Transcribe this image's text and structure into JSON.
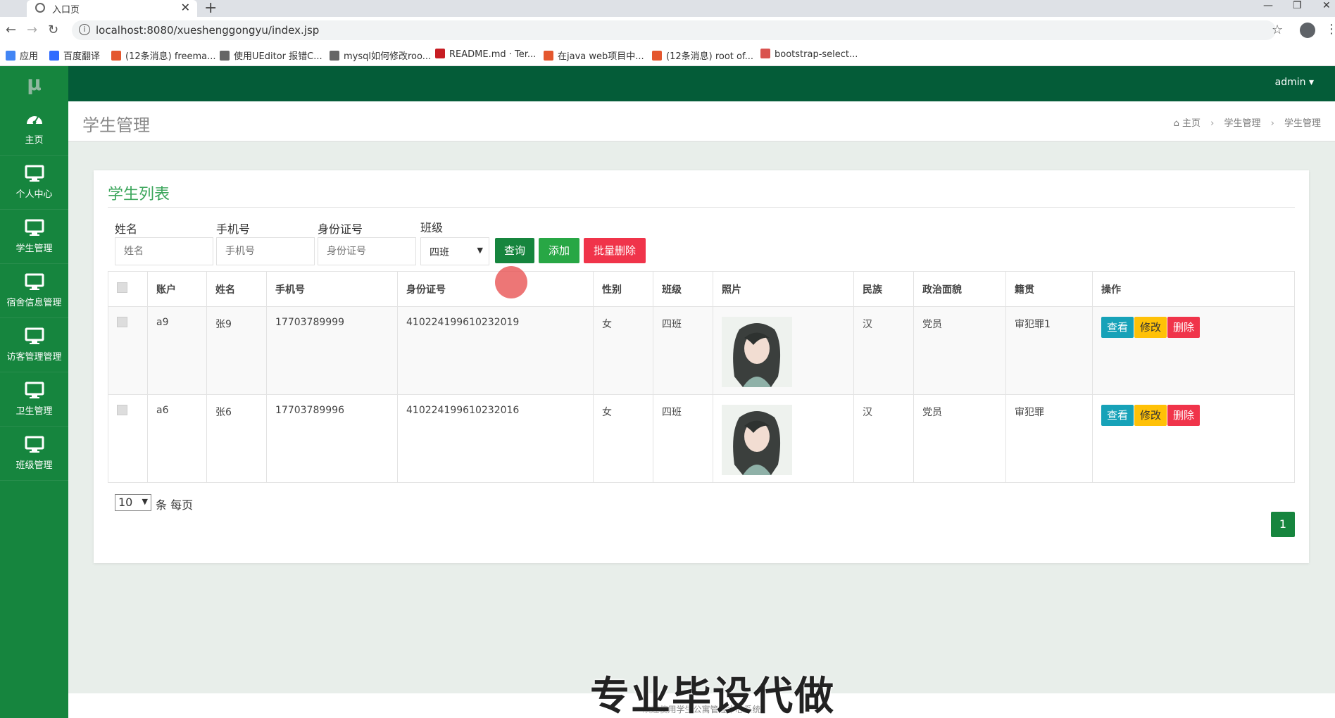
{
  "browser": {
    "tab_title": "入口页",
    "tab_close": "✕",
    "new_tab": "+",
    "url": "localhost:8080/xueshenggongyu/index.jsp",
    "bookmarks": [
      {
        "label": "应用",
        "color": "#4285f4"
      },
      {
        "label": "百度翻译",
        "color": "#2f6bff"
      },
      {
        "label": "(12条消息) freema...",
        "color": "#e4572e"
      },
      {
        "label": "使用UEditor 报错C...",
        "color": "#666666"
      },
      {
        "label": "mysql如何修改roo...",
        "color": "#666666"
      },
      {
        "label": "README.md · Ter...",
        "color": "#c71d23"
      },
      {
        "label": "在java web项目中...",
        "color": "#e4572e"
      },
      {
        "label": "(12条消息) root of...",
        "color": "#e4572e"
      },
      {
        "label": "bootstrap-select...",
        "color": "#d9534f"
      }
    ]
  },
  "sidebar": {
    "logo": "μ",
    "items": [
      {
        "label": "主页",
        "icon": "dashboard-icon"
      },
      {
        "label": "个人中心",
        "icon": "monitor-icon"
      },
      {
        "label": "学生管理",
        "icon": "monitor-icon"
      },
      {
        "label": "宿舍信息管理",
        "icon": "monitor-icon"
      },
      {
        "label": "访客管理管理",
        "icon": "monitor-icon"
      },
      {
        "label": "卫生管理",
        "icon": "monitor-icon"
      },
      {
        "label": "班级管理",
        "icon": "monitor-icon"
      }
    ]
  },
  "topbar": {
    "user": "admin ▾"
  },
  "header": {
    "title": "学生管理",
    "breadcrumb": [
      "主页",
      "学生管理",
      "学生管理"
    ]
  },
  "card": {
    "title": "学生列表"
  },
  "filters": {
    "name_label": "姓名",
    "name_placeholder": "姓名",
    "phone_label": "手机号",
    "phone_placeholder": "手机号",
    "id_label": "身份证号",
    "id_placeholder": "身份证号",
    "class_label": "班级",
    "class_value": "四班",
    "search_btn": "查询",
    "add_btn": "添加",
    "batch_delete_btn": "批量删除"
  },
  "table": {
    "headers": [
      "账户",
      "姓名",
      "手机号",
      "身份证号",
      "性别",
      "班级",
      "照片",
      "民族",
      "政治面貌",
      "籍贯",
      "操作"
    ],
    "rows": [
      {
        "account": "a9",
        "name": "张9",
        "phone": "17703789999",
        "idcard": "410224199610232019",
        "gender": "女",
        "class": "四班",
        "ethnicity": "汉",
        "politics": "党员",
        "hometown": "审犯罪1"
      },
      {
        "account": "a6",
        "name": "张6",
        "phone": "17703789996",
        "idcard": "410224199610232016",
        "gender": "女",
        "class": "四班",
        "ethnicity": "汉",
        "politics": "党员",
        "hometown": "审犯罪"
      }
    ],
    "actions": {
      "view": "查看",
      "edit": "修改",
      "delete": "删除"
    }
  },
  "pagination": {
    "page_size": "10",
    "per_page_text": "条 每页",
    "current_page": "1"
  },
  "footer": {
    "text": "欢迎使用学生公寓管理中心系统"
  },
  "watermark": "专业毕设代做",
  "colors": {
    "sidebar": "#16853e",
    "topbar": "#045c38",
    "title": "#3aa55a",
    "search": "#16853e",
    "add": "#28a745",
    "danger": "#f0344a",
    "view": "#17a2b8",
    "edit": "#ffc107"
  }
}
